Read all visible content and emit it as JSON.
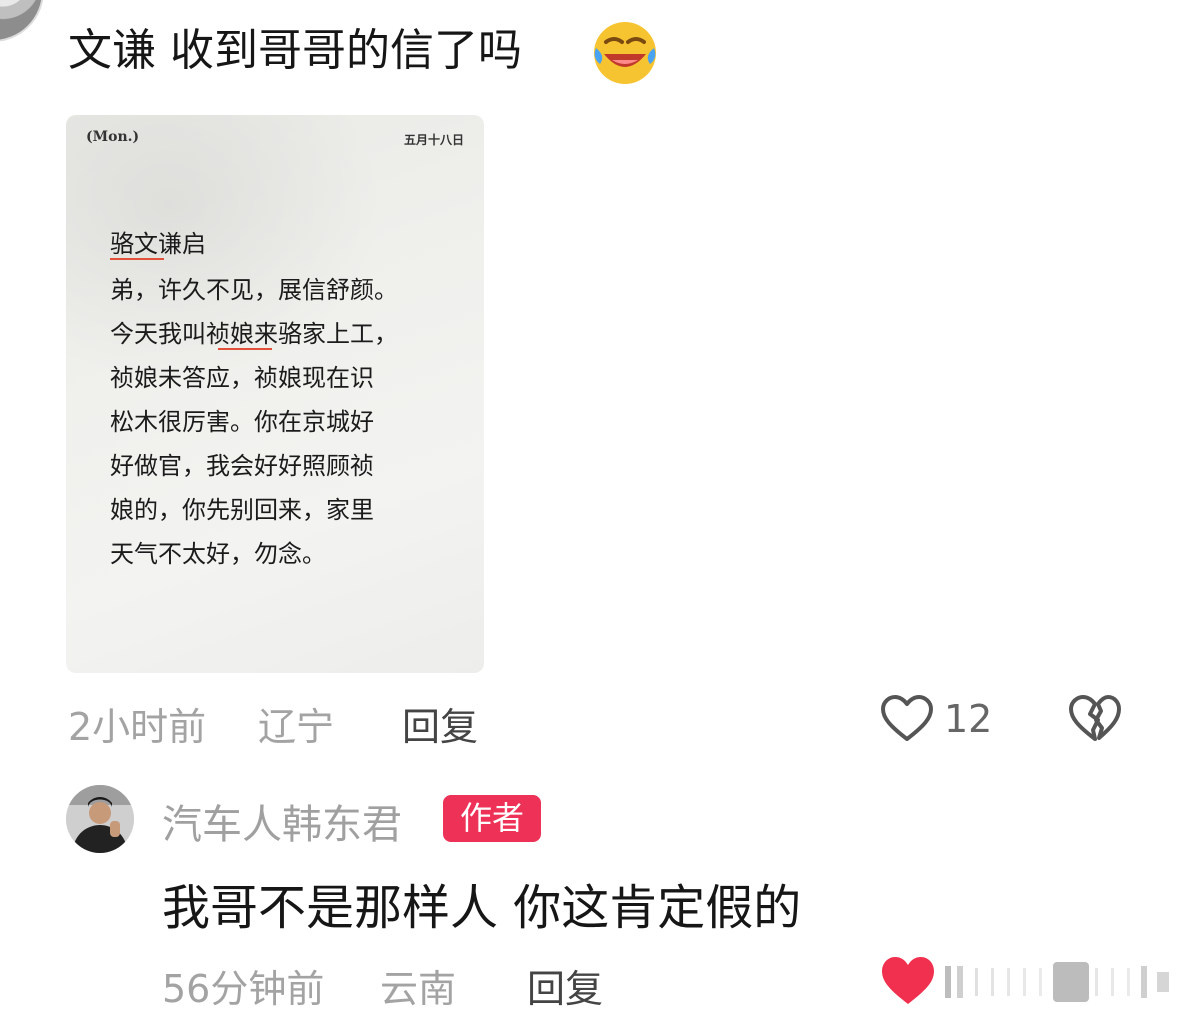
{
  "comment": {
    "text": "文谦 收到哥哥的信了吗",
    "emoji": "face-with-tears-of-joy",
    "letter": {
      "day": "(Mon.)",
      "date": "五月十八日",
      "lines": [
        "骆文谦启",
        "弟，许久不见，展信舒颜。",
        "今天我叫祯娘来骆家上工，",
        "祯娘未答应，祯娘现在识",
        "松木很厉害。你在京城好",
        "好做官，我会好好照顾祯",
        "娘的，你先别回来，家里",
        "天气不太好，勿念。"
      ]
    },
    "meta": {
      "time": "2小时前",
      "location": "辽宁",
      "reply_label": "回复",
      "like_count": "12"
    }
  },
  "reply": {
    "author": "汽车人韩东君",
    "badge": "作者",
    "text": "我哥不是那样人  你这肯定假的",
    "meta": {
      "time": "56分钟前",
      "location": "云南",
      "reply_label": "回复"
    }
  },
  "colors": {
    "badge": "#ee3156",
    "liked_heart": "#f0304e",
    "meta_gray": "#a3a3a3"
  }
}
